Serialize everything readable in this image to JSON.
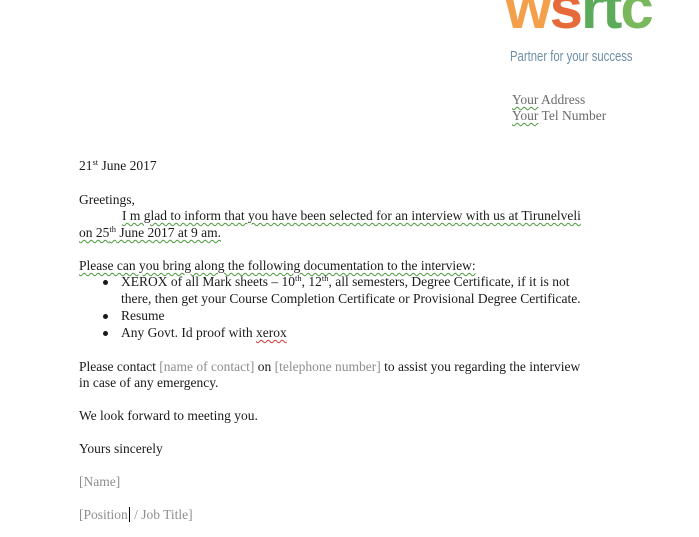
{
  "logo": {
    "mark": "wsrtc",
    "tagline": "Partner for your success",
    "colors": {
      "orange": "#f4a04b",
      "red": "#e66a3a",
      "green": "#5bab5a",
      "tagline": "#6d8ea8"
    }
  },
  "sender": {
    "address": "Your Address",
    "telephone": "Your Tel Number"
  },
  "letter": {
    "date": {
      "day": "21",
      "suffix": "st",
      "rest": " June 2017"
    },
    "salutation": "Greetings,",
    "intro": {
      "line1": "I m glad to inform that you have been selected  for an interview  with us at Tirunelveli",
      "line2_prefix": "on 25",
      "line2_suffix": "th",
      "line2_rest": " June 2017 at 9 am."
    },
    "request": "Please can you bring along the following documentation to the interview:",
    "items": {
      "item1_a": "XEROX of all Mark sheets – 10",
      "item1_sup1": "th",
      "item1_b": ", 12",
      "item1_sup2": "th",
      "item1_c": ", all semesters,  Degree Certificate,  if it is not",
      "item1_line2": "there, then get your Course Completion Certificate or Provisional Degree Certificate.",
      "item2": "Resume",
      "item3": "Any Govt. Id proof with xerox"
    },
    "contact": {
      "pre": "Please contact ",
      "contact_placeholder": "[name of contact]",
      "mid": " on ",
      "phone_placeholder": "[telephone number]",
      "post": " to assist  you regarding the interview",
      "line2": "in case of any emergency."
    },
    "closing_line": "We look  forward to meeting you.",
    "signoff": "Yours sincerely",
    "name_placeholder": "[Name]",
    "position_placeholder_a": "[Position",
    "position_placeholder_b": " / Job Title]"
  }
}
